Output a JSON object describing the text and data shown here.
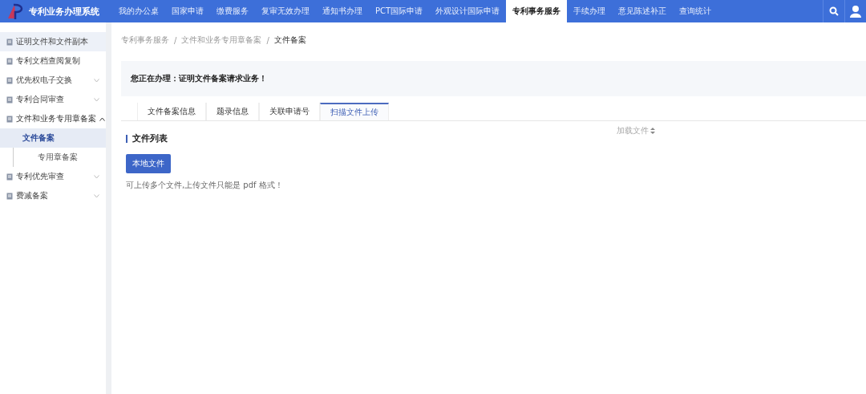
{
  "app": {
    "title": "专利业务办理系统"
  },
  "nav": [
    {
      "label": "我的办公桌",
      "selected": false
    },
    {
      "label": "国家申请",
      "selected": false
    },
    {
      "label": "缴费服务",
      "selected": false
    },
    {
      "label": "复审无效办理",
      "selected": false
    },
    {
      "label": "通知书办理",
      "selected": false
    },
    {
      "label": "PCT国际申请",
      "selected": false
    },
    {
      "label": "外观设计国际申请",
      "selected": false
    },
    {
      "label": "专利事务服务",
      "selected": true
    },
    {
      "label": "手续办理",
      "selected": false
    },
    {
      "label": "意见陈述补正",
      "selected": false
    },
    {
      "label": "查询统计",
      "selected": false
    }
  ],
  "sidebar": {
    "items": [
      {
        "label": "证明文件和文件副本",
        "selected": true
      },
      {
        "label": "专利文档查阅复制",
        "selected": false
      },
      {
        "label": "优先权电子交换",
        "selected": false,
        "expanded": false
      },
      {
        "label": "专利合同审查",
        "selected": false,
        "expanded": false
      },
      {
        "label": "文件和业务专用章备案",
        "selected": false,
        "expanded": true,
        "children": [
          {
            "label": "文件备案",
            "selected": true
          },
          {
            "label": "专用章备案",
            "selected": false
          }
        ]
      },
      {
        "label": "专利优先审查",
        "selected": false,
        "expanded": false
      },
      {
        "label": "费减备案",
        "selected": false,
        "expanded": false
      }
    ]
  },
  "breadcrumb": {
    "separator": "/",
    "items": [
      "专利事务服务",
      "文件和业务专用章备案",
      "文件备案"
    ]
  },
  "notice": {
    "prefix": "您正在办理：",
    "text": "证明文件备案请求业务！"
  },
  "tabs": [
    {
      "label": "文件备案信息",
      "selected": false
    },
    {
      "label": "题录信息",
      "selected": false
    },
    {
      "label": "关联申请号",
      "selected": false
    },
    {
      "label": "扫描文件上传",
      "selected": true
    }
  ],
  "file_list": {
    "title": "文件列表",
    "sort_label": "加载文件",
    "upload_button": "本地文件",
    "hint": "可上传多个文件,上传文件只能是 pdf 格式！"
  }
}
